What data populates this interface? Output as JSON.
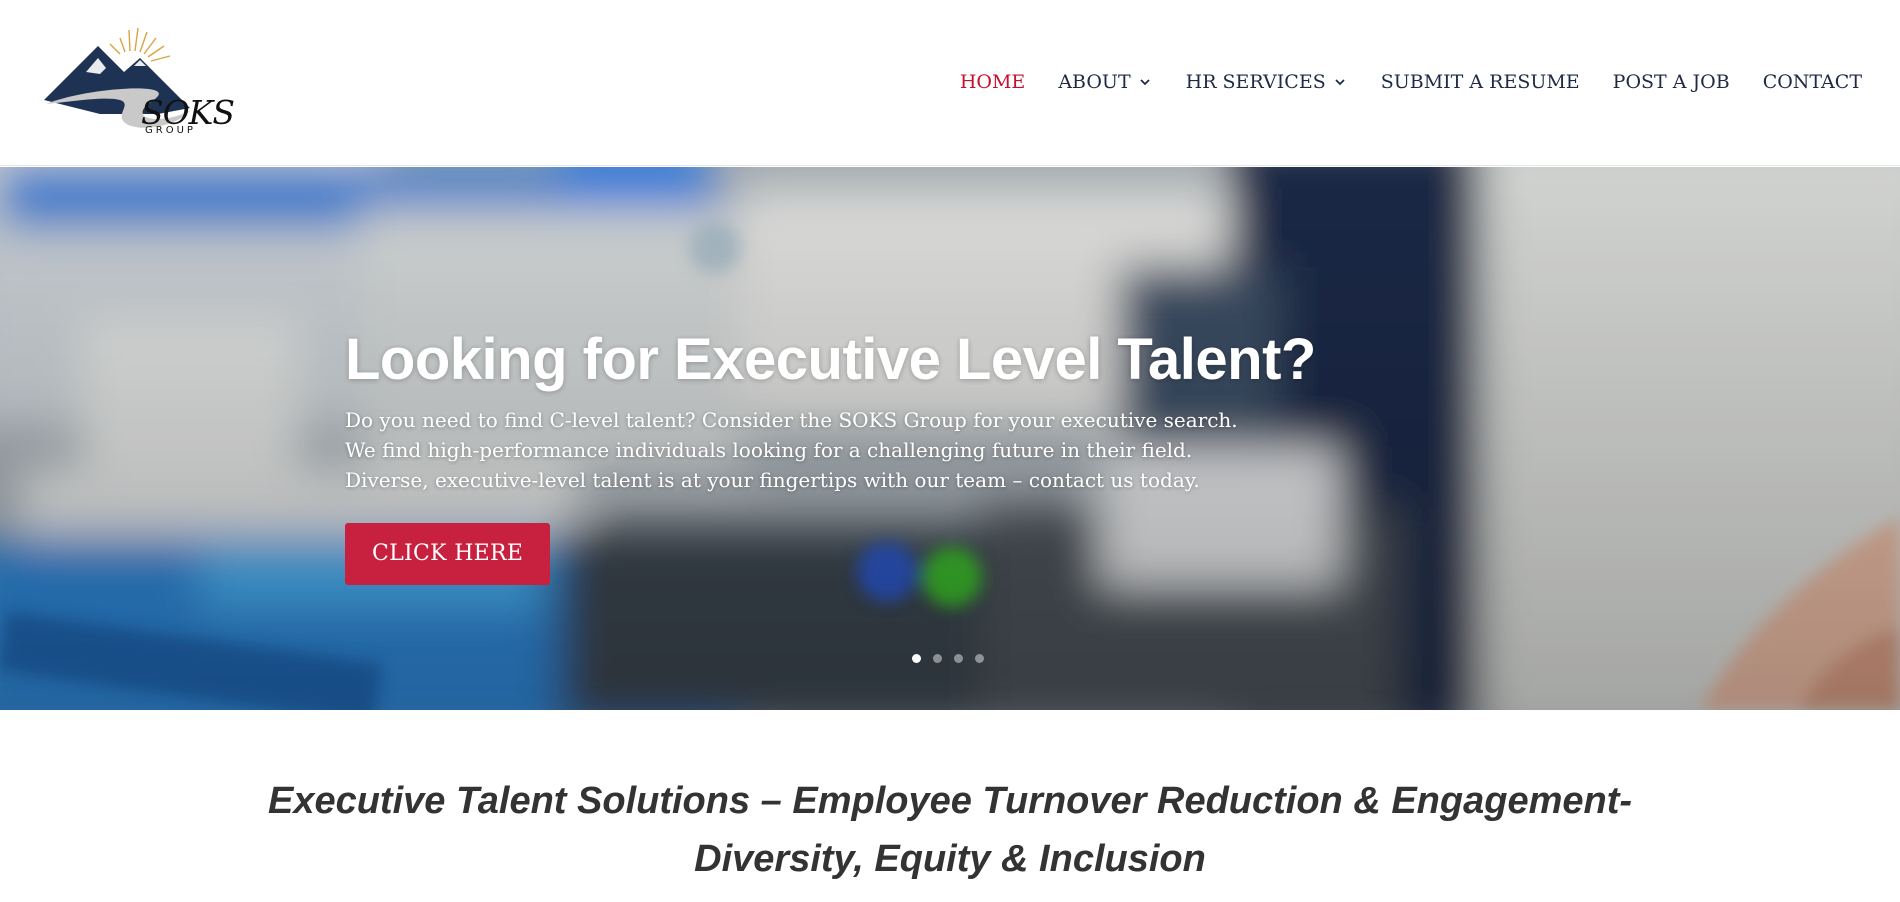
{
  "brand": {
    "logo_word": "SOKS",
    "logo_sub": "GROUP"
  },
  "nav": {
    "items": [
      {
        "label": "HOME",
        "active": true,
        "has_dropdown": false
      },
      {
        "label": "ABOUT",
        "active": false,
        "has_dropdown": true
      },
      {
        "label": "HR SERVICES",
        "active": false,
        "has_dropdown": true
      },
      {
        "label": "SUBMIT A RESUME",
        "active": false,
        "has_dropdown": false
      },
      {
        "label": "POST A JOB",
        "active": false,
        "has_dropdown": false
      },
      {
        "label": "CONTACT",
        "active": false,
        "has_dropdown": false
      }
    ]
  },
  "hero": {
    "title": "Looking for Executive Level Talent?",
    "lines": [
      "Do you need to find C-level talent? Consider the SOKS Group for your executive search.",
      "We find high-performance individuals looking for a challenging future in their field.",
      "Diverse, executive-level talent is at your fingertips with our team – contact us today."
    ],
    "button_label": "CLICK HERE",
    "slide_count": 4,
    "active_slide": 1
  },
  "tagline": {
    "line1": "Executive Talent Solutions – Employee Turnover Reduction & Engagement-",
    "line2": "Diversity, Equity & Inclusion"
  },
  "colors": {
    "accent": "#c8102e",
    "button": "#c8213f",
    "nav_text": "#1f2a44",
    "tagline_text": "#333333",
    "logo_navy": "#1e3253",
    "logo_gold": "#d9a441"
  },
  "icons": {
    "dropdown": "chevron-down-icon",
    "logo": "mountain-sun-logo"
  }
}
